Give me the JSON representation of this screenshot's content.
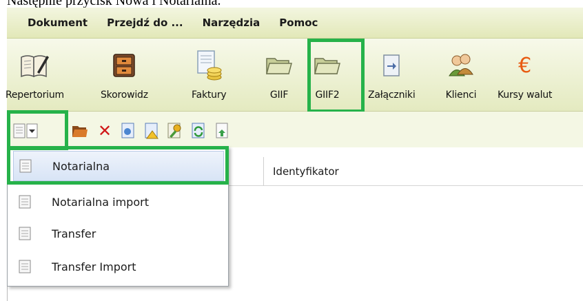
{
  "document": {
    "text": "Następnie przycisk Nowa i Notarialna."
  },
  "menubar": {
    "items": [
      "Dokument",
      "Przejdź do ...",
      "Narzędzia",
      "Pomoc"
    ]
  },
  "toolbar_big": {
    "items": [
      {
        "label": "Repertorium",
        "icon": "book-pen-icon"
      },
      {
        "label": "Skorowidz",
        "icon": "cabinet-icon"
      },
      {
        "label": "Faktury",
        "icon": "invoice-coins-icon"
      },
      {
        "label": "GIIF",
        "icon": "folder-icon"
      },
      {
        "label": "GIIF2",
        "icon": "folder-icon"
      },
      {
        "label": "Załączniki",
        "icon": "attachment-doc-icon"
      },
      {
        "label": "Klienci",
        "icon": "clients-icon"
      },
      {
        "label": "Kursy walut",
        "icon": "euro-icon"
      }
    ]
  },
  "toolbar_small": {
    "icons": [
      "new-doc-dropdown-icon",
      "open-folder-icon",
      "delete-icon",
      "document-blue-icon",
      "document-warning-icon",
      "key-doc-icon",
      "refresh-doc-icon",
      "export-doc-icon"
    ]
  },
  "table": {
    "columns": [
      "Identyfikator"
    ]
  },
  "dropdown": {
    "items": [
      "Notarialna",
      "Notarialna import",
      "Transfer",
      "Transfer Import"
    ]
  },
  "colors": {
    "highlight": "#26b24a",
    "menubar": "#e2e8b8",
    "selected_row": "#d8e4f6"
  }
}
